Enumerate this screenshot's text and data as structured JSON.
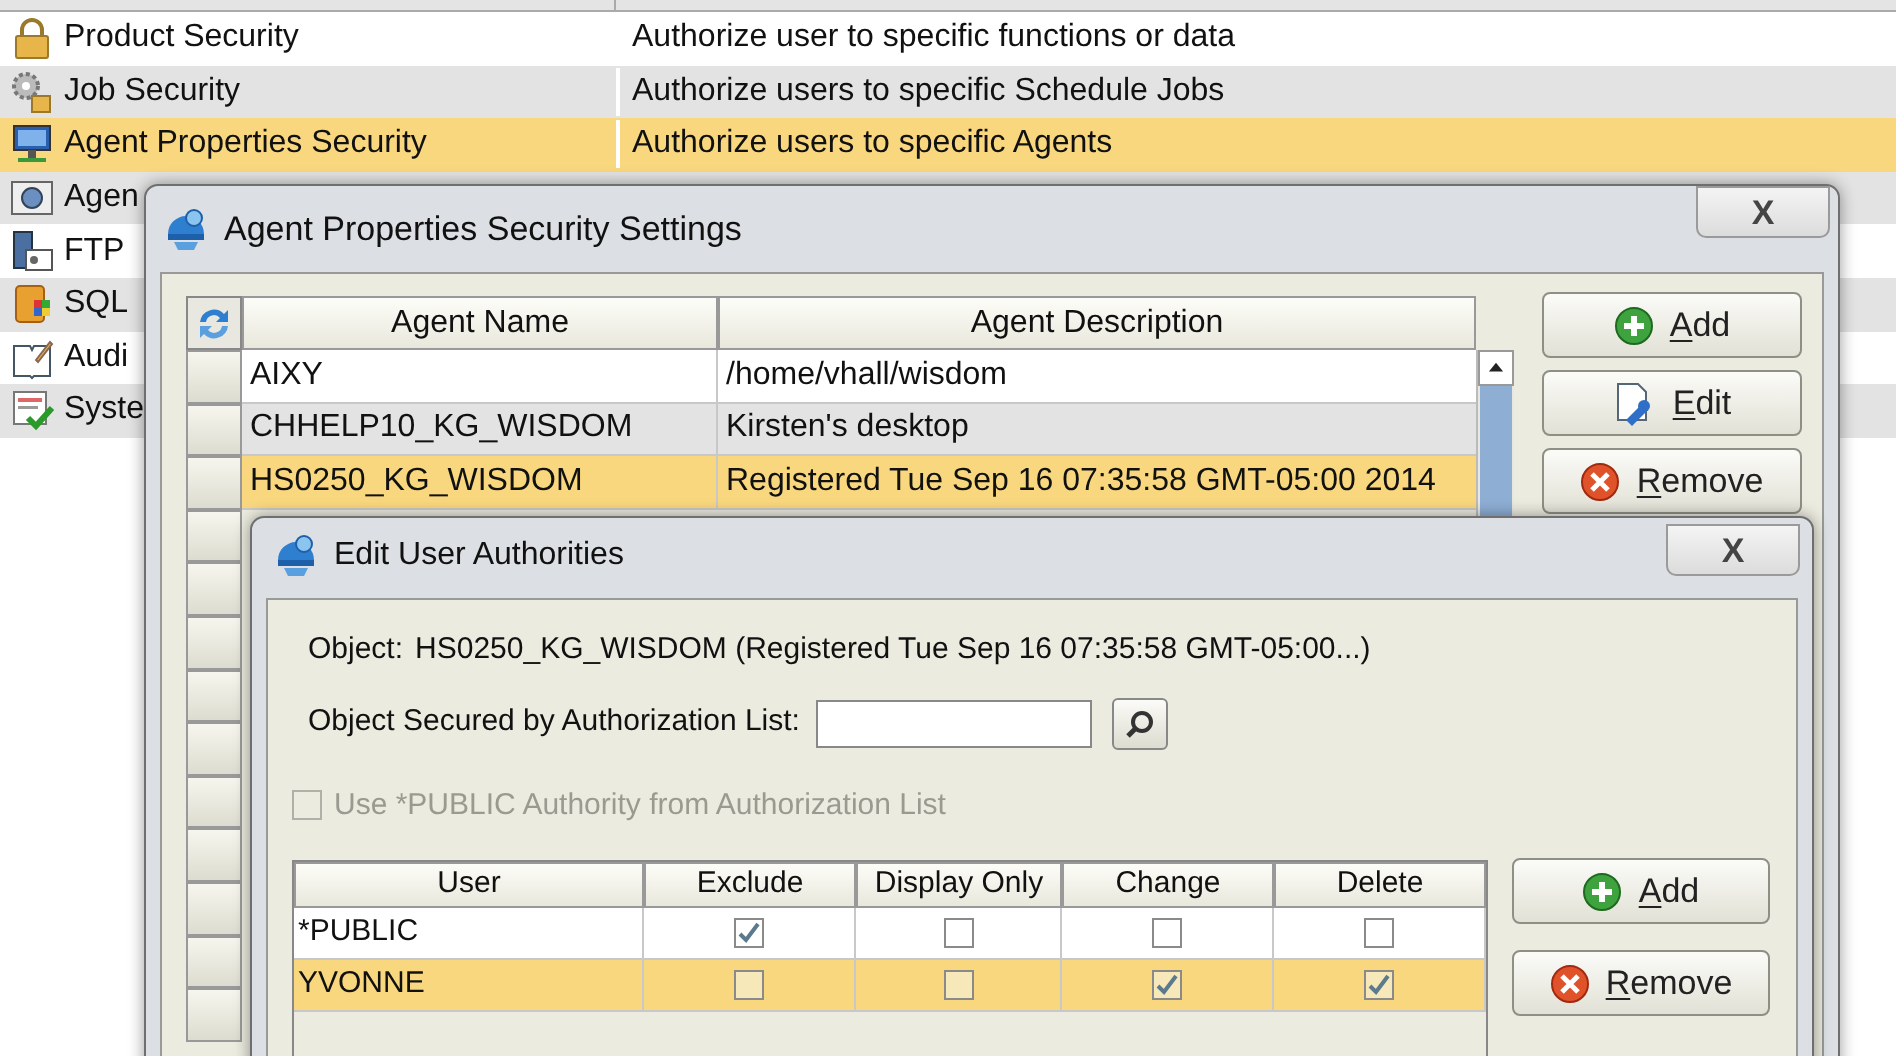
{
  "security_list": {
    "rows": [
      {
        "kind": "lock",
        "name": "Product Security",
        "description": "Authorize user to specific functions or data",
        "selected": false
      },
      {
        "kind": "gears",
        "name": "Job Security",
        "description": "Authorize users to specific Schedule Jobs",
        "selected": false
      },
      {
        "kind": "monitor",
        "name": "Agent Properties Security",
        "description": "Authorize users to specific Agents",
        "selected": true
      },
      {
        "kind": "globe",
        "name": "Agen",
        "selected": false
      },
      {
        "kind": "server",
        "name": "FTP",
        "selected": false
      },
      {
        "kind": "database",
        "name": "SQL",
        "selected": false
      },
      {
        "kind": "book",
        "name": "Audi",
        "selected": false
      },
      {
        "kind": "checklist",
        "name": "Syste",
        "selected": false
      }
    ]
  },
  "settings_dialog": {
    "title": "Agent Properties Security Settings",
    "close": "X",
    "table": {
      "columns": [
        "Agent Name",
        "Agent Description"
      ],
      "rows": [
        {
          "name": "AIXY",
          "description": "/home/vhall/wisdom",
          "selected": false
        },
        {
          "name": "CHHELP10_KG_WISDOM",
          "description": "Kirsten's desktop",
          "selected": false
        },
        {
          "name": "HS0250_KG_WISDOM",
          "description": "Registered Tue Sep 16 07:35:58 GMT-05:00 2014",
          "selected": true
        }
      ]
    },
    "buttons": [
      {
        "kind": "add",
        "label": "Add"
      },
      {
        "kind": "edit",
        "label": "Edit"
      },
      {
        "kind": "remove",
        "label": "Remove"
      }
    ]
  },
  "authorities_dialog": {
    "title": "Edit User Authorities",
    "close": "X",
    "object_label": "Object:",
    "object_value": "HS0250_KG_WISDOM (Registered Tue Sep 16 07:35:58 GMT-05:00...)",
    "auth_list_label": "Object Secured by Authorization List:",
    "use_public": {
      "label": "Use *PUBLIC Authority from Authorization List",
      "checked": false,
      "disabled": true
    },
    "table": {
      "columns": [
        "User",
        "Exclude",
        "Display Only",
        "Change",
        "Delete"
      ],
      "rows": [
        {
          "user": "*PUBLIC",
          "exclude": true,
          "display_only": false,
          "change": false,
          "delete": false,
          "selected": false
        },
        {
          "user": "YVONNE",
          "exclude": false,
          "display_only": false,
          "change": true,
          "delete": true,
          "selected": true
        }
      ]
    },
    "buttons": [
      {
        "kind": "add",
        "label": "Add"
      },
      {
        "kind": "remove",
        "label": "Remove"
      }
    ]
  }
}
